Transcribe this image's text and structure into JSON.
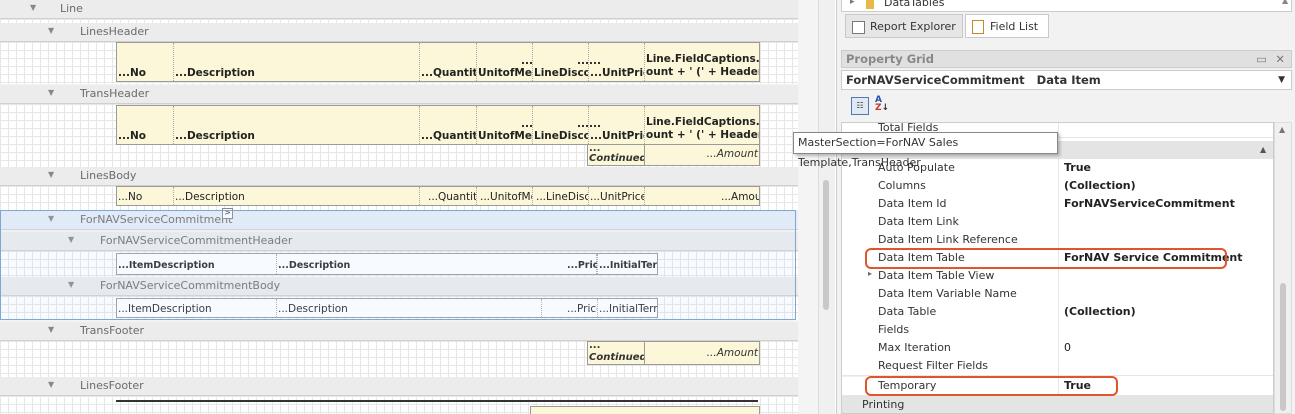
{
  "designer": {
    "bands": {
      "line": "Line",
      "lines_header": "LinesHeader",
      "trans_header": "TransHeader",
      "lines_body": "LinesBody",
      "service_commitment": "ForNAVServiceCommitment",
      "service_commitment_header": "ForNAVServiceCommitmentHeader",
      "service_commitment_body": "ForNAVServiceCommitmentBody",
      "trans_footer": "TransFooter",
      "lines_footer": "LinesFooter"
    },
    "header_cells": {
      "no": "...No",
      "description": "...Description",
      "quantity": "...Quantity",
      "unit_of_measure": "UnitofMea",
      "line_discount": "LineDiscou",
      "unit_price": "...UnitPrice",
      "ellipsis": "...",
      "amount_line1": "Line.FieldCaptions.Am",
      "amount_line2": "ount + ' (' + Header.Fi"
    },
    "trans_extra": {
      "continued": "Continued",
      "ellipsis": "...",
      "amount": "...Amount"
    },
    "body_cells": {
      "no": "...No",
      "description": "...Description",
      "quantity": "...Quantity",
      "unit_of_measure": "...UnitofMe",
      "line_discount": "...LineDisco",
      "unit_price": "...UnitPrice",
      "amount": "...Amount"
    },
    "commit_header_cells": {
      "item_description": "...ItemDescription",
      "description": "...Description",
      "price": "...Price",
      "initial_term": "...InitialTerm"
    },
    "commit_body_cells": {
      "item_description": "...ItemDescription",
      "description": "...Description",
      "price": "...Price",
      "initial_term": "...InitialTerm"
    },
    "trans_footer_cells": {
      "ellipsis": "...",
      "continued": "Continued",
      "amount": "...Amount"
    },
    "smart_tag": ">"
  },
  "tooltip": "MasterSection=ForNAV Sales Template,TransHeader",
  "right_panel": {
    "tree_item": "DataTables",
    "tabs": {
      "report_explorer": "Report Explorer",
      "field_list": "Field List"
    },
    "property_grid_title": "Property Grid",
    "object_name": "ForNAVServiceCommitment",
    "object_type": "Data Item",
    "properties": [
      {
        "name": "Total Fields",
        "value": ""
      },
      {
        "name": "Auto Populate",
        "value": "True",
        "bold": true
      },
      {
        "name": "Columns",
        "value": "(Collection)",
        "bold": true
      },
      {
        "name": "Data Item Id",
        "value": "ForNAVServiceCommitment",
        "bold": true
      },
      {
        "name": "Data Item Link",
        "value": ""
      },
      {
        "name": "Data Item Link Reference",
        "value": ""
      },
      {
        "name": "Data Item Table",
        "value": "ForNAV Service Commitment",
        "bold": true
      },
      {
        "name": "Data Item Table View",
        "value": ""
      },
      {
        "name": "Data Item Variable Name",
        "value": ""
      },
      {
        "name": "Data Table",
        "value": "(Collection)",
        "bold": true
      },
      {
        "name": "Fields",
        "value": ""
      },
      {
        "name": "Max Iteration",
        "value": "0"
      },
      {
        "name": "Request Filter Fields",
        "value": ""
      },
      {
        "name": "Temporary",
        "value": "True",
        "bold": true
      }
    ],
    "category_printing": "Printing"
  }
}
